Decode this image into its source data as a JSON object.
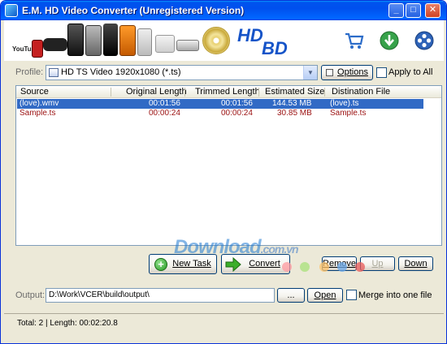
{
  "window": {
    "title": "E.M. HD Video Converter (Unregistered Version)",
    "minimize_label": "_",
    "maximize_label": "□",
    "close_label": "✕"
  },
  "banner": {
    "brand_hd": "HD",
    "brand_bd": "BD",
    "youtube_label": "YouTube",
    "icons": [
      "shopping-cart-icon",
      "download-update-icon",
      "film-reel-icon"
    ]
  },
  "profile": {
    "label": "Profile:",
    "selected": "HD TS Video 1920x1080 (*.ts)",
    "options_button": "Options",
    "apply_all_label": "Apply to All",
    "apply_all_checked": false
  },
  "file_list": {
    "columns": [
      "Source",
      "Original Length",
      "Trimmed Length",
      "Estimated Size",
      "Distination File"
    ],
    "rows": [
      {
        "source": "(love).wmv",
        "original": "00:01:56",
        "trimmed": "00:01:56",
        "size": "144.53 MB",
        "destination": "(love).ts",
        "selected": true
      },
      {
        "source": "Sample.ts",
        "original": "00:00:24",
        "trimmed": "00:00:24",
        "size": "30.85 MB",
        "destination": "Sample.ts",
        "selected": false
      }
    ]
  },
  "actions": {
    "new_task": "New Task",
    "convert": "Convert",
    "remove": "Remove",
    "up": "Up",
    "down": "Down"
  },
  "output": {
    "label": "Output:",
    "path": "D:\\Work\\VCER\\build\\output\\",
    "browse": "...",
    "open": "Open",
    "merge_label": "Merge into one file",
    "merge_checked": false
  },
  "status": {
    "text": "Total: 2 | Length: 00:02:20.8"
  },
  "watermark": {
    "text": "Download",
    "tld": ".com.vn"
  },
  "colors": {
    "selection": "#316ac5",
    "row_text": "#9b1010",
    "titlebar": "#0054e3"
  }
}
